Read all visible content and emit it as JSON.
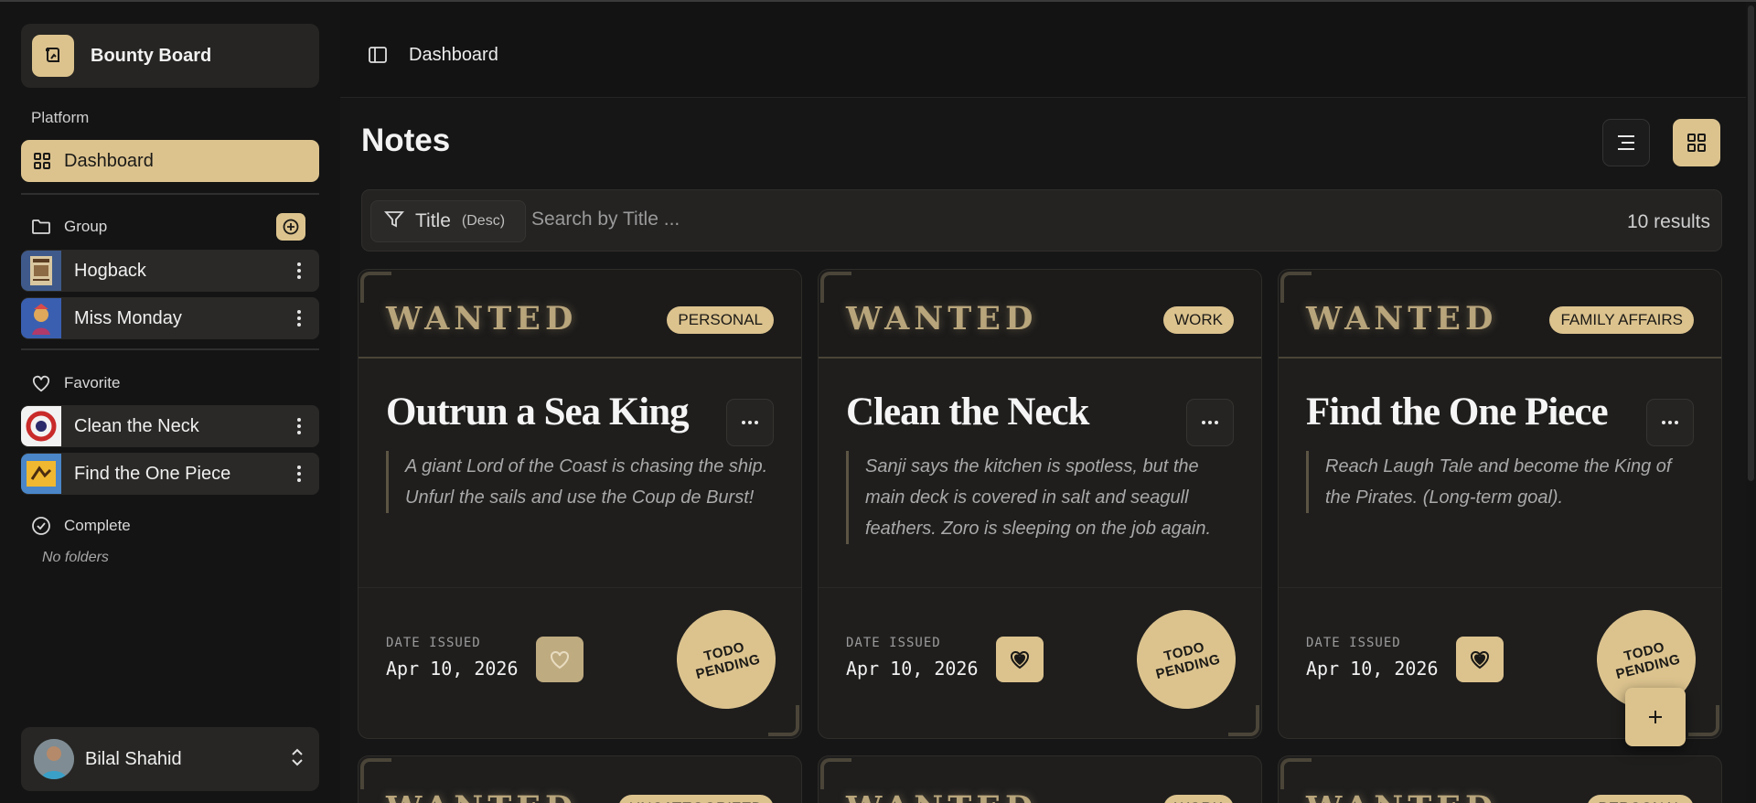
{
  "app": {
    "name": "Bounty Board"
  },
  "sidebar": {
    "platform_label": "Platform",
    "dashboard_label": "Dashboard",
    "group_label": "Group",
    "groups": [
      {
        "name": "Hogback"
      },
      {
        "name": "Miss Monday"
      }
    ],
    "favorite_label": "Favorite",
    "favorites": [
      {
        "name": "Clean the Neck"
      },
      {
        "name": "Find the One Piece"
      }
    ],
    "complete_label": "Complete",
    "no_folders": "No folders",
    "user": {
      "name": "Bilal Shahid"
    }
  },
  "header": {
    "breadcrumb": "Dashboard"
  },
  "main": {
    "title": "Notes",
    "filter": {
      "field": "Title",
      "order": "(Desc)",
      "search_placeholder": "Search by Title ...",
      "results": "10 results"
    }
  },
  "cards": [
    {
      "header": "WANTED",
      "tag": "PERSONAL",
      "title": "Outrun a Sea King",
      "description": "A giant Lord of the Coast is chasing the ship. Unfurl the sails and use the Coup de Burst!",
      "date_label": "DATE ISSUED",
      "date": "Apr 10, 2026",
      "favorited": false,
      "stamp_line1": "TODO",
      "stamp_line2": "PENDING"
    },
    {
      "header": "WANTED",
      "tag": "WORK",
      "title": "Clean the Neck",
      "description": "Sanji says the kitchen is spotless, but the main deck is covered in salt and seagull feathers. Zoro is sleeping on the job again.",
      "date_label": "DATE ISSUED",
      "date": "Apr 10, 2026",
      "favorited": true,
      "stamp_line1": "TODO",
      "stamp_line2": "PENDING"
    },
    {
      "header": "WANTED",
      "tag": "FAMILY AFFAIRS",
      "title": "Find the One Piece",
      "description": "Reach Laugh Tale and become the King of the Pirates. (Long-term goal).",
      "date_label": "DATE ISSUED",
      "date": "Apr 10, 2026",
      "favorited": true,
      "stamp_line1": "TODO",
      "stamp_line2": "PENDING"
    }
  ],
  "peek_cards": [
    {
      "header": "WANTED",
      "tag": "UNCATEGORIZED"
    },
    {
      "header": "WANTED",
      "tag": "WORK"
    },
    {
      "header": "WANTED",
      "tag": "PERSONAL"
    }
  ],
  "colors": {
    "accent": "#dcc38e",
    "background": "#121212",
    "card": "#1f1e1d"
  }
}
